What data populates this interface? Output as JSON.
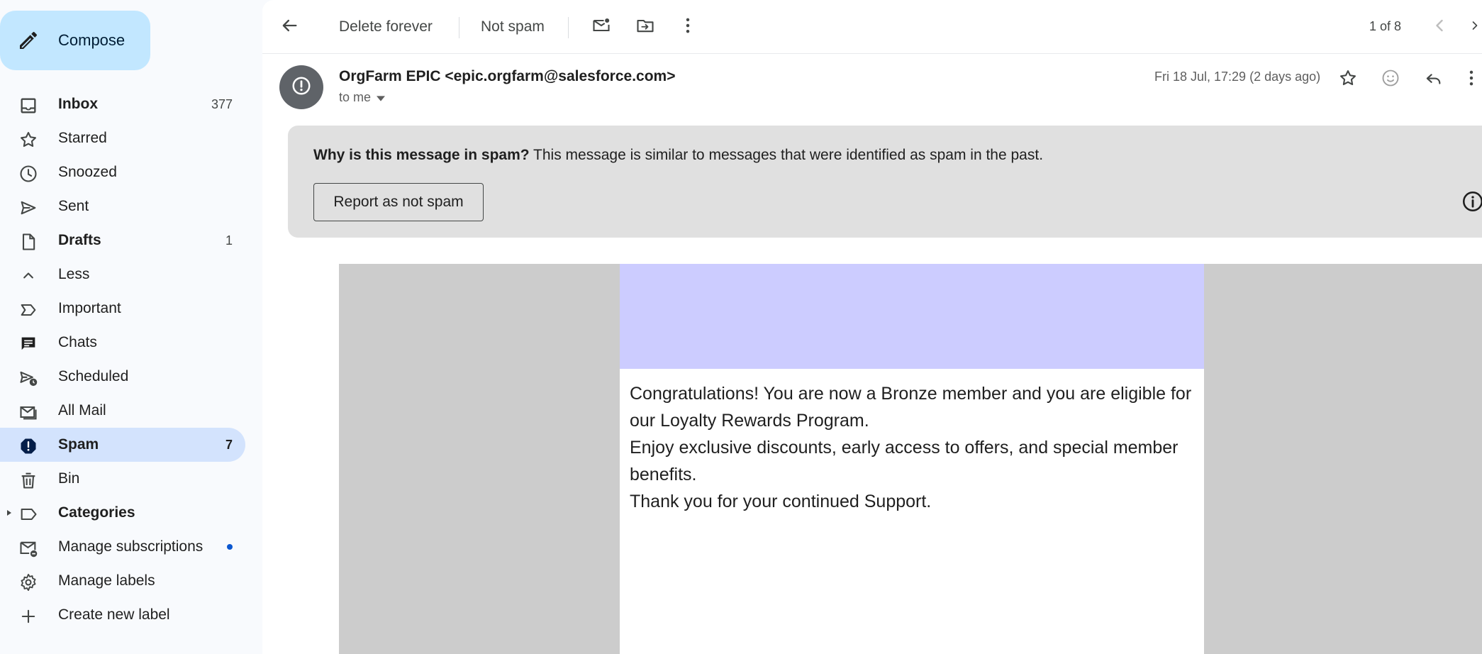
{
  "sidebar": {
    "compose_label": "Compose",
    "items": [
      {
        "label": "Inbox",
        "count": "377"
      },
      {
        "label": "Starred"
      },
      {
        "label": "Snoozed"
      },
      {
        "label": "Sent"
      },
      {
        "label": "Drafts",
        "count": "1"
      },
      {
        "label": "Less"
      },
      {
        "label": "Important"
      },
      {
        "label": "Chats"
      },
      {
        "label": "Scheduled"
      },
      {
        "label": "All Mail"
      },
      {
        "label": "Spam",
        "count": "7"
      },
      {
        "label": "Bin"
      },
      {
        "label": "Categories"
      },
      {
        "label": "Manage subscriptions"
      },
      {
        "label": "Manage labels"
      },
      {
        "label": "Create new label"
      }
    ]
  },
  "toolbar": {
    "delete_forever": "Delete forever",
    "not_spam": "Not spam",
    "pager": "1 of 8"
  },
  "message": {
    "sender": "OrgFarm EPIC <epic.orgfarm@salesforce.com>",
    "to": "to me",
    "date": "Fri 18 Jul, 17:29 (2 days ago)"
  },
  "spam_banner": {
    "question": "Why is this message in spam?",
    "explanation": " This message is similar to messages that were identified as spam in the past.",
    "report_button": "Report as not spam"
  },
  "email": {
    "line1": "Congratulations! You are now a Bronze member and you are eligible for our Loyalty Rewards Program.",
    "line2": "Enjoy exclusive discounts, early access to offers, and special member benefits.",
    "line3": "Thank you for your continued Support."
  },
  "colors": {
    "compose_bg": "#c2e7ff",
    "active_nav_bg": "#d3e3fd",
    "spam_banner_bg": "#e0e0e0",
    "email_banner_bg": "#ccccff",
    "email_outer_bg": "#cccccc",
    "subscription_dot": "#0b57d0"
  },
  "icons": {
    "compose": "pencil-icon",
    "back": "arrow-left-icon",
    "mark_unread": "mail-unread-icon",
    "move_to": "move-to-folder-icon",
    "more": "more-vert-icon"
  }
}
